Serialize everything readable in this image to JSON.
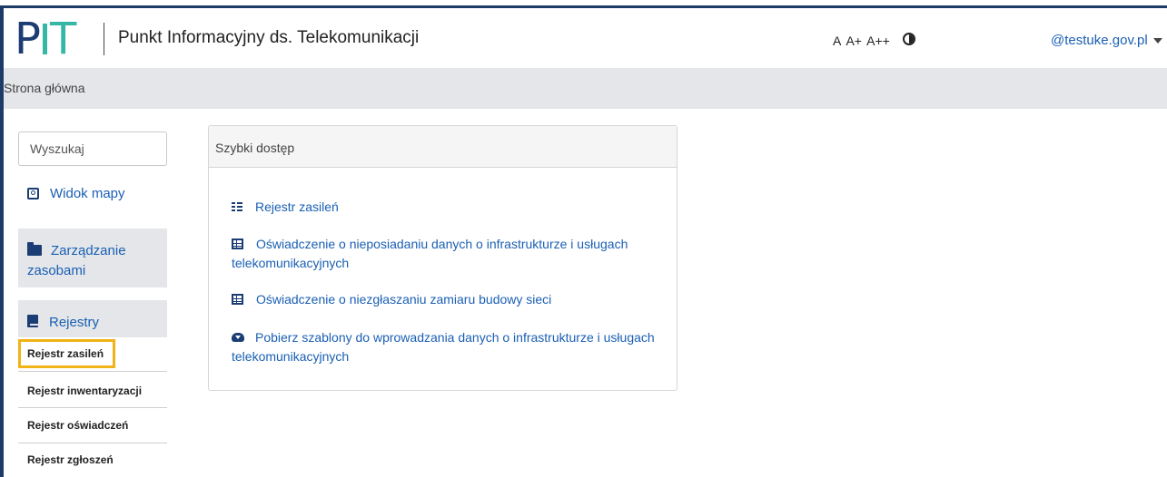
{
  "header": {
    "logo_text": "PIT",
    "title": "Punkt Informacyjny ds. Telekomunikacji",
    "font_sizes": [
      "A",
      "A+",
      "A++"
    ],
    "contrast_icon": "contrast-icon",
    "user_label": "@testuke.gov.pl"
  },
  "breadcrumb": {
    "home": "Strona główna"
  },
  "sidebar": {
    "search_placeholder": "Wyszukaj",
    "map_view": "Widok mapy",
    "resource_mgmt": "Zarządzanie zasobami",
    "registers": "Rejestry",
    "sub_items": [
      "Rejestr zasileń",
      "Rejestr inwentaryzacji",
      "Rejestr oświadczeń",
      "Rejestr zgłoszeń"
    ]
  },
  "quick_access": {
    "title": "Szybki dostęp",
    "links": [
      "Rejestr zasileń",
      "Oświadczenie o nieposiadaniu danych o infrastrukturze i usługach telekomunikacyjnych",
      "Oświadczenie o niezgłaszaniu zamiaru budowy sieci",
      "Pobierz szablony do wprowadzania danych o infrastrukturze i usługach telekomunikacyjnych"
    ]
  },
  "colors": {
    "brand_navy": "#1d3c74",
    "brand_teal": "#35b7a6",
    "link": "#1a5fb4",
    "highlight": "#f2b316"
  }
}
